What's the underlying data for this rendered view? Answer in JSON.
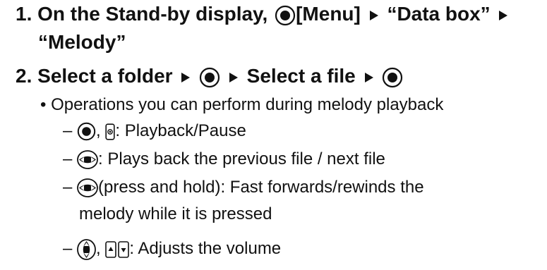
{
  "step1": {
    "number": "1.",
    "text_a": "On the Stand-by display,",
    "menu_label": "[Menu]",
    "item1": "“Data box”",
    "item2": "“Melody”"
  },
  "step2": {
    "number": "2.",
    "text_a": "Select a folder",
    "text_b": "Select a file"
  },
  "operations": {
    "heading": "• Operations you can perform during melody playback",
    "items": [
      {
        "dash": "–",
        "text": ": Playback/Pause"
      },
      {
        "dash": "–",
        "text": ": Plays back the previous file / next file"
      },
      {
        "dash": "–",
        "text": "(press and hold): Fast forwards/rewinds the",
        "continuation": "melody while it is pressed"
      },
      {
        "dash": "–",
        "text": ": Adjusts the volume"
      }
    ],
    "comma": ","
  },
  "icons": {
    "center_key": "center-select-key-icon",
    "arrow": "play-triangle-arrow-icon",
    "side_key": "side-key-icon",
    "left_right_key": "left-right-navigation-key-icon",
    "up_down_key": "up-down-navigation-key-icon",
    "volume_keys": "volume-up-down-keys-icon"
  },
  "colors": {
    "text": "#111111",
    "icon_fill": "#111111"
  }
}
